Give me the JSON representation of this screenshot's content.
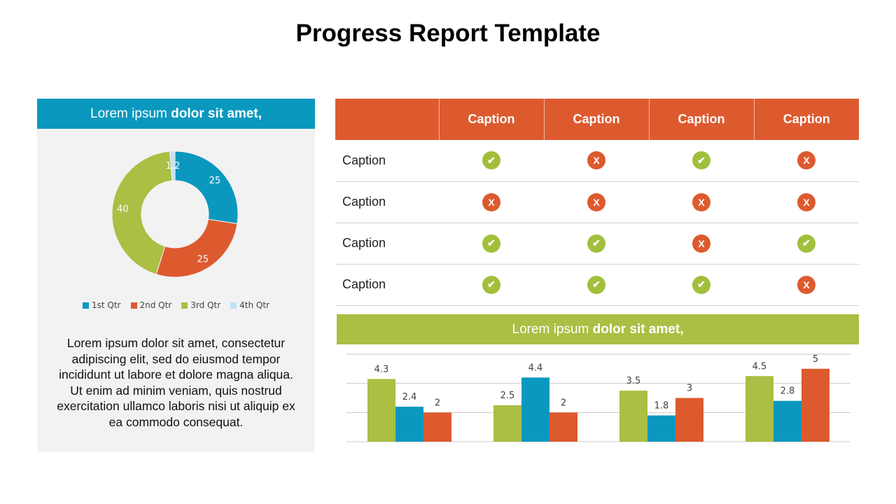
{
  "title": "Progress Report Template",
  "left_panel": {
    "heading_normal": "Lorem ipsum ",
    "heading_bold": "dolor sit amet,",
    "body": "Lorem ipsum dolor sit amet, consectetur adipiscing elit, sed do eiusmod tempor incididunt ut labore et dolore magna aliqua. Ut enim ad minim veniam, quis nostrud exercitation ullamco laboris nisi ut aliquip ex ea commodo consequat."
  },
  "bottom_panel": {
    "heading_normal": "Lorem ipsum ",
    "heading_bold": "dolor sit amet,"
  },
  "table": {
    "headers": [
      "",
      "Caption",
      "Caption",
      "Caption",
      "Caption"
    ],
    "rows": [
      {
        "label": "Caption",
        "status": [
          "check",
          "x",
          "check",
          "x"
        ]
      },
      {
        "label": "Caption",
        "status": [
          "x",
          "x",
          "x",
          "x"
        ]
      },
      {
        "label": "Caption",
        "status": [
          "check",
          "check",
          "x",
          "check"
        ]
      },
      {
        "label": "Caption",
        "status": [
          "check",
          "check",
          "check",
          "x"
        ]
      }
    ],
    "colors": {
      "header": "#dd5a2f",
      "check": "#a2bf3c",
      "x": "#dd5a2f"
    }
  },
  "chart_data": [
    {
      "type": "pie",
      "variant": "donut",
      "categories": [
        "1st Qtr",
        "2nd Qtr",
        "3rd Qtr",
        "4th Qtr"
      ],
      "values": [
        25,
        25,
        40,
        1.2
      ],
      "colors": [
        "#0a98bf",
        "#dd5a2f",
        "#aabf43",
        "#bde3f7"
      ],
      "legend": "bottom"
    },
    {
      "type": "bar",
      "categories": [
        "",
        "",
        "",
        ""
      ],
      "series": [
        {
          "values": [
            4.3,
            2.5,
            3.5,
            4.5
          ],
          "color": "#aabf43"
        },
        {
          "values": [
            2.4,
            4.4,
            1.8,
            2.8
          ],
          "color": "#0a98bf"
        },
        {
          "values": [
            2,
            2,
            3,
            5
          ],
          "color": "#dd5a2f"
        }
      ],
      "ylim": [
        0,
        6
      ],
      "grid": true
    }
  ]
}
